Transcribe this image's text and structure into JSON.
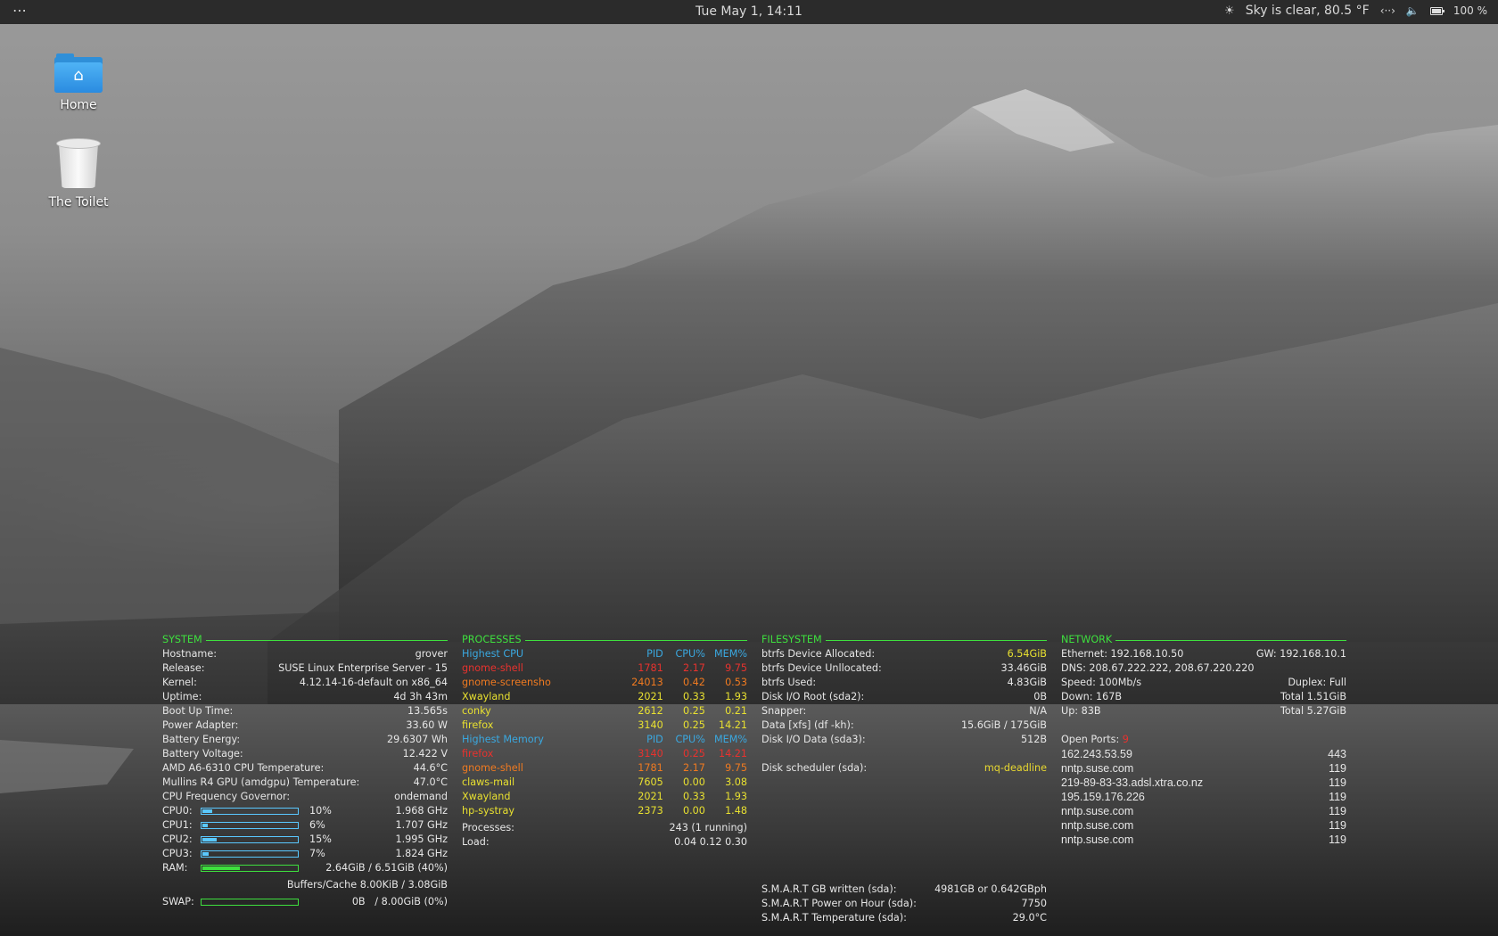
{
  "topbar": {
    "menu_icon": "⋯",
    "clock": "Tue May  1, 14:11",
    "weather_icon": "☀",
    "weather": "Sky is clear, 80.5 °F",
    "network_icon": "‹··›",
    "volume_icon": "🔈",
    "battery_percent": "100 %"
  },
  "desktop": {
    "home_label": "Home",
    "trash_label": "The Toilet"
  },
  "system": {
    "header": "SYSTEM",
    "rows": [
      {
        "k": "Hostname:",
        "v": "grover"
      },
      {
        "k": "Release:",
        "v": "SUSE Linux Enterprise Server - 15"
      },
      {
        "k": "Kernel:",
        "v": "4.12.14-16-default on x86_64"
      },
      {
        "k": "Uptime:",
        "v": "4d 3h 43m"
      },
      {
        "k": "Boot Up Time:",
        "v": "13.565s"
      },
      {
        "k": "Power Adapter:",
        "v": "33.60 W"
      },
      {
        "k": "Battery Energy:",
        "v": "29.6307 Wh"
      },
      {
        "k": "Battery Voltage:",
        "v": "12.422 V"
      },
      {
        "k": "AMD A6-6310 CPU Temperature:",
        "v": "44.6°C"
      },
      {
        "k": "Mullins R4 GPU (amdgpu) Temperature:",
        "v": "47.0°C"
      },
      {
        "k": "CPU Frequency Governor:",
        "v": "ondemand"
      }
    ],
    "cpus": [
      {
        "label": "CPU0:",
        "pct": "10%",
        "fill": 0.1,
        "freq": "1.968 GHz"
      },
      {
        "label": "CPU1:",
        "pct": "6%",
        "fill": 0.06,
        "freq": "1.707 GHz"
      },
      {
        "label": "CPU2:",
        "pct": "15%",
        "fill": 0.15,
        "freq": "1.995 GHz"
      },
      {
        "label": "CPU3:",
        "pct": "7%",
        "fill": 0.07,
        "freq": "1.824 GHz"
      }
    ],
    "ram": {
      "label": "RAM:",
      "fill": 0.4,
      "value": "2.64GiB / 6.51GiB (40%)"
    },
    "buffers": "Buffers/Cache 8.00KiB / 3.08GiB",
    "swap": {
      "label": "SWAP:",
      "fill": 0.0,
      "value": "0B   / 8.00GiB (0%)"
    }
  },
  "processes": {
    "header": "PROCESSES",
    "cpu_title": "Highest CPU",
    "mem_title": "Highest Memory",
    "col_pid": "PID",
    "col_cpu": "CPU%",
    "col_mem": "MEM%",
    "top_cpu": [
      {
        "name": "gnome-shell",
        "pid": "1781",
        "cpu": "2.17",
        "mem": "9.75",
        "color": "#e8322e"
      },
      {
        "name": "gnome-screensho",
        "pid": "24013",
        "cpu": "0.42",
        "mem": "0.53",
        "color": "#f07a20"
      },
      {
        "name": "Xwayland",
        "pid": "2021",
        "cpu": "0.33",
        "mem": "1.93",
        "color": "#e8e030"
      },
      {
        "name": "conky",
        "pid": "2612",
        "cpu": "0.25",
        "mem": "0.21",
        "color": "#e8e030"
      },
      {
        "name": "firefox",
        "pid": "3140",
        "cpu": "0.25",
        "mem": "14.21",
        "color": "#e8e030"
      }
    ],
    "top_mem": [
      {
        "name": "firefox",
        "pid": "3140",
        "cpu": "0.25",
        "mem": "14.21",
        "color": "#e8322e"
      },
      {
        "name": "gnome-shell",
        "pid": "1781",
        "cpu": "2.17",
        "mem": "9.75",
        "color": "#f07a20"
      },
      {
        "name": "claws-mail",
        "pid": "7605",
        "cpu": "0.00",
        "mem": "3.08",
        "color": "#e8e030"
      },
      {
        "name": "Xwayland",
        "pid": "2021",
        "cpu": "0.33",
        "mem": "1.93",
        "color": "#e8e030"
      },
      {
        "name": "hp-systray",
        "pid": "2373",
        "cpu": "0.00",
        "mem": "1.48",
        "color": "#e8e030"
      }
    ],
    "procs_label": "Processes:",
    "procs_value": "243 (1 running)",
    "load_label": "Load:",
    "load_value": "0.04 0.12 0.30"
  },
  "filesystem": {
    "header": "FILESYSTEM",
    "rows": [
      {
        "k": "btrfs Device Allocated:",
        "v": "6.54GiB",
        "hl": true
      },
      {
        "k": "btrfs Device Unllocated:",
        "v": "33.46GiB"
      },
      {
        "k": "btrfs Used:",
        "v": "4.83GiB"
      },
      {
        "k": "Disk I/O Root (sda2):",
        "v": "0B"
      },
      {
        "k": "Snapper:",
        "v": "N/A"
      },
      {
        "k": "Data [xfs] (df -kh):",
        "v": "15.6GiB / 175GiB"
      },
      {
        "k": "Disk I/O Data (sda3):",
        "v": "512B"
      }
    ],
    "scheduler_label": "Disk scheduler (sda):",
    "scheduler_value": "mq-deadline",
    "smart": [
      {
        "k": "S.M.A.R.T GB written (sda):",
        "v": "4981GB or 0.642GBph"
      },
      {
        "k": "S.M.A.R.T Power on Hour (sda):",
        "v": "7750"
      },
      {
        "k": "S.M.A.R.T Temperature (sda):",
        "v": "29.0°C"
      }
    ]
  },
  "network": {
    "header": "NETWORK",
    "ethernet": "Ethernet: 192.168.10.50",
    "gw": "GW: 192.168.10.1",
    "dns": "DNS: 208.67.222.222, 208.67.220.220",
    "speed": "Speed: 100Mb/s",
    "duplex": "Duplex: Full",
    "down": "Down: 167B",
    "total_down": "Total 1.51GiB",
    "up": "Up: 83B",
    "total_up": "Total 5.27GiB",
    "open_ports_label": "Open Ports:",
    "open_ports_count": "9",
    "ports": [
      {
        "host": "162.243.53.59",
        "port": "443"
      },
      {
        "host": "nntp.suse.com",
        "port": "119"
      },
      {
        "host": "219-89-83-33.adsl.xtra.co.nz",
        "port": "119"
      },
      {
        "host": "195.159.176.226",
        "port": "119"
      },
      {
        "host": "nntp.suse.com",
        "port": "119"
      },
      {
        "host": "nntp.suse.com",
        "port": "119"
      },
      {
        "host": "nntp.suse.com",
        "port": "119"
      }
    ]
  }
}
